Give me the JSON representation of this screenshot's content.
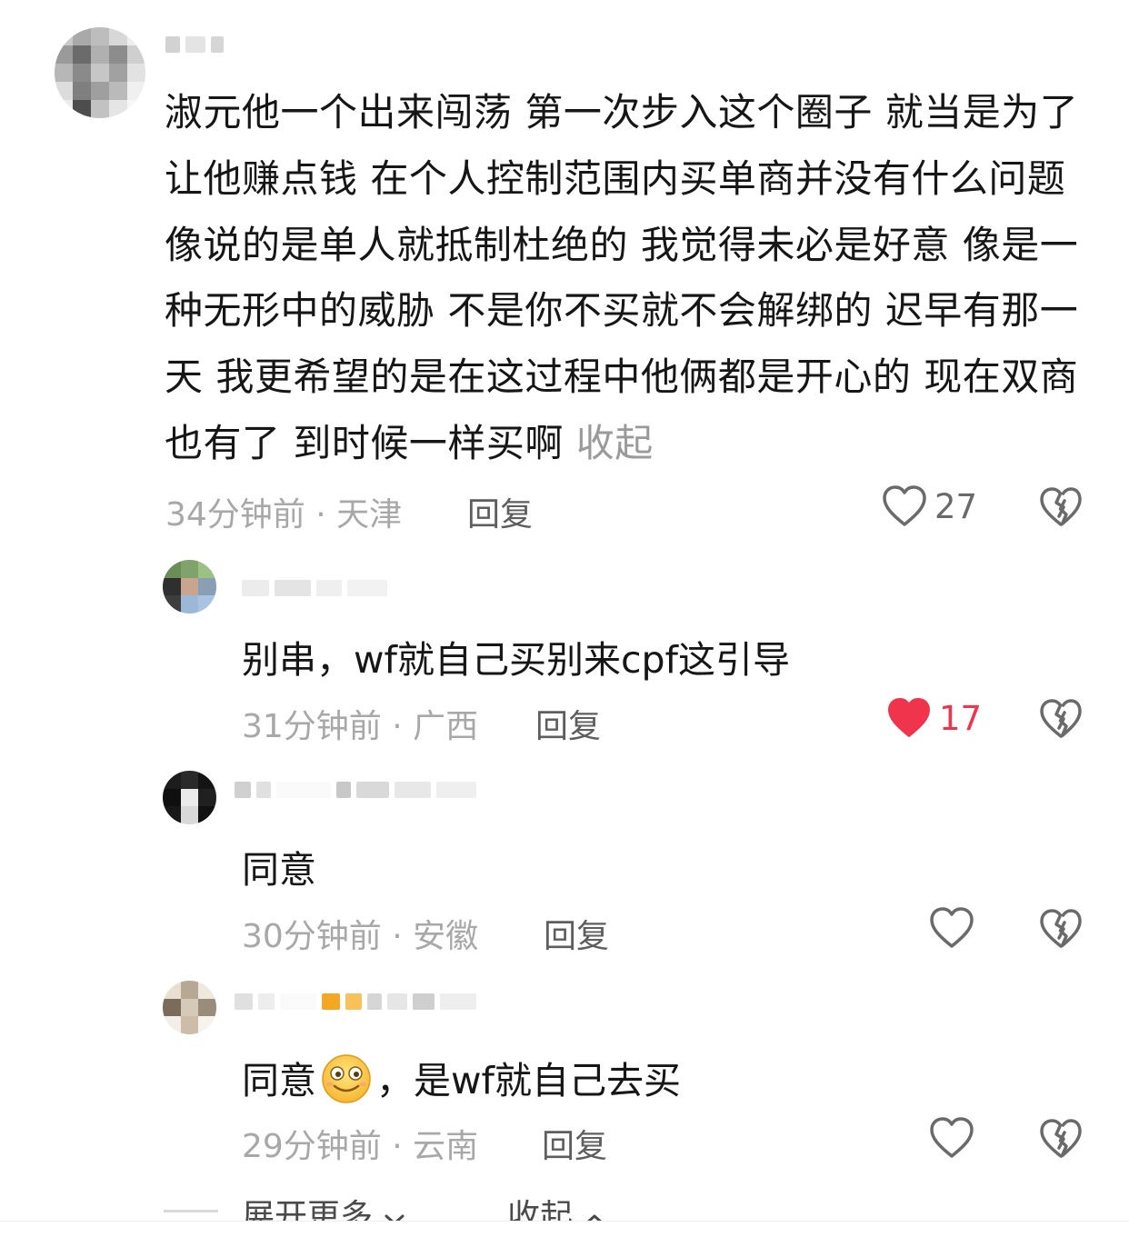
{
  "comments": [
    {
      "text_prefix": "淑元他一个出来闯荡 第一次步入这个圈子 就当是为了让他赚点钱 在个人控制范围内买单商并没有什么问题 像说的是单人就抵制杜绝的 我觉得未必是好意 像是一种无形中的威胁 不是你不买就不会解绑的 迟早有那一天 我更希望的是在这过程中他俩都是开心的 现在双商也有了 到时候一样买啊",
      "collapse_label": "收起",
      "meta": "34分钟前 · 天津",
      "reply_label": "回复",
      "likes": "27"
    },
    {
      "text": "别串，wf就自己买别来cpf这引导",
      "meta": "31分钟前 · 广西",
      "reply_label": "回复",
      "likes": "17",
      "liked": true
    },
    {
      "text": "同意",
      "meta": "30分钟前 · 安徽",
      "reply_label": "回复"
    },
    {
      "text_before_emoji": "同意",
      "emoji": "smiling-emoji",
      "text_after_emoji": "，是wf就自己去买",
      "meta": "29分钟前 · 云南",
      "reply_label": "回复"
    }
  ],
  "footer": {
    "expand_more": "展开更多",
    "collapse": "收起"
  },
  "colors": {
    "liked_red": "#f0344c",
    "meta_gray": "#a8a8a8",
    "text": "#161616"
  }
}
